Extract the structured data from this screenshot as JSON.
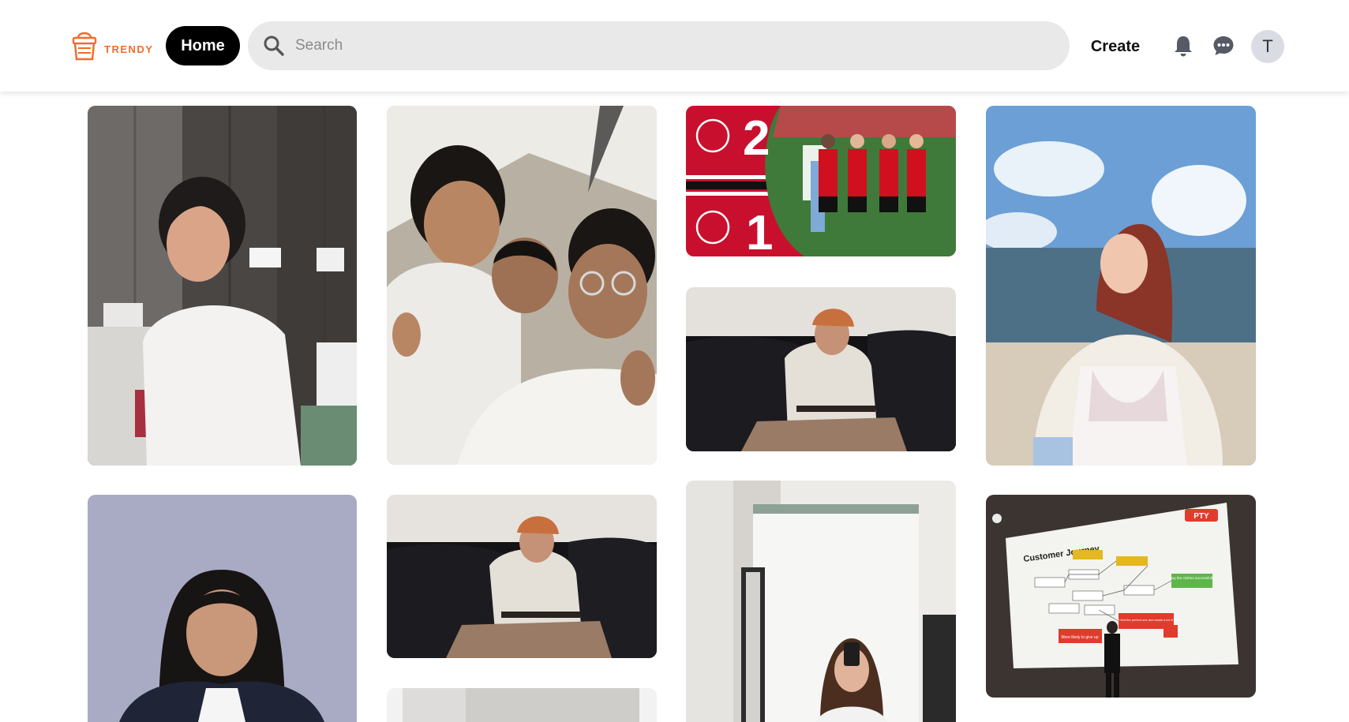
{
  "header": {
    "logo_text": "TRENDY",
    "home_label": "Home",
    "search_placeholder": "Search",
    "create_label": "Create",
    "avatar_initial": "T"
  },
  "icons": {
    "logo": "shopping-basket-logo-icon",
    "search": "search-icon",
    "notifications": "bell-icon",
    "messages": "chat-bubble-icon"
  },
  "colors": {
    "accent": "#f26b2a",
    "home_button_bg": "#000000",
    "search_bg": "#e9e9e9",
    "avatar_bg": "#dadce3"
  },
  "feed": {
    "pins": [
      {
        "id": "pin-1",
        "description": "young man in white t-shirt smiling in office"
      },
      {
        "id": "pin-2",
        "description": "selfie of three young men with thumbs up"
      },
      {
        "id": "pin-3",
        "description": "Manchester United 2 Manchester City 1 graphic"
      },
      {
        "id": "pin-4",
        "description": "woman posing on beach with blue sky"
      },
      {
        "id": "pin-5",
        "description": "man in hoodie and orange cap on black sofa"
      },
      {
        "id": "pin-6",
        "description": "portrait of woman with long dark hair"
      },
      {
        "id": "pin-7",
        "description": "man in hoodie and orange cap on black sofa"
      },
      {
        "id": "pin-8",
        "description": "woman taking mirror selfie by curtain"
      },
      {
        "id": "pin-9",
        "description": "presentation slide on stage"
      },
      {
        "id": "pin-10",
        "description": "room with curtain partially visible"
      }
    ],
    "score_graphic": {
      "home_score": "2",
      "away_score": "1"
    },
    "slide": {
      "title": "Customer Journey",
      "badge": "PTY",
      "nodes": [
        "Buy the clothes successfully",
        "Can't find the perfect one and waste a lot of time",
        "More likely to give up"
      ]
    }
  }
}
